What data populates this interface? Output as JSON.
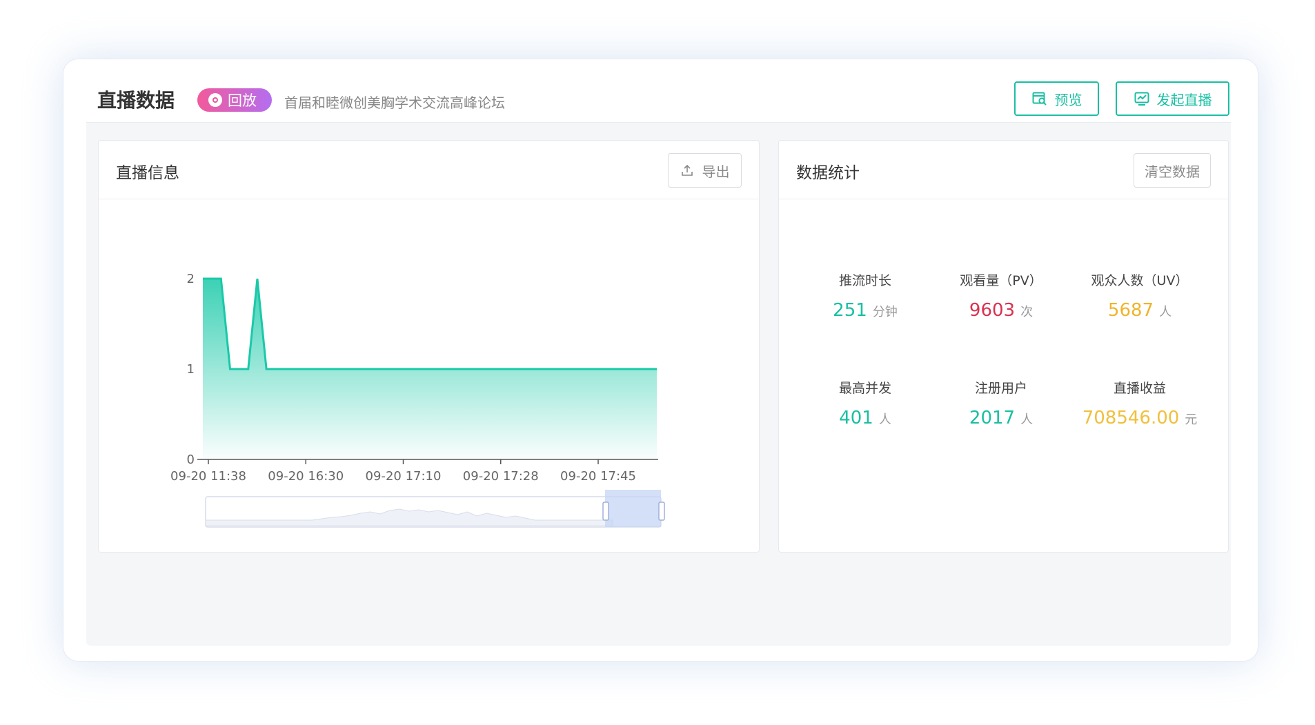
{
  "header": {
    "title": "直播数据",
    "badge_label": "回放",
    "event_name": "首届和睦微创美胸学术交流高峰论坛",
    "preview_label": "预览",
    "start_live_label": "发起直播"
  },
  "live_info": {
    "title": "直播信息",
    "export_label": "导出"
  },
  "stats_panel": {
    "title": "数据统计",
    "clear_label": "清空数据",
    "items": [
      {
        "label": "推流时长",
        "value": "251",
        "unit": "分钟",
        "color": "#19bfa3"
      },
      {
        "label": "观看量（PV）",
        "value": "9603",
        "unit": "次",
        "color": "#d9314f"
      },
      {
        "label": "观众人数（UV）",
        "value": "5687",
        "unit": "人",
        "color": "#f0b428"
      },
      {
        "label": "最高并发",
        "value": "401",
        "unit": "人",
        "color": "#19bfa3"
      },
      {
        "label": "注册用户",
        "value": "2017",
        "unit": "人",
        "color": "#19bfa3"
      },
      {
        "label": "直播收益",
        "value": "708546.00",
        "unit": "元",
        "color": "#f0c03c"
      }
    ]
  },
  "chart_data": {
    "type": "area",
    "title": "",
    "xlabel": "",
    "ylabel": "",
    "x_tick_labels": [
      "09-20 11:38",
      "09-20 16:30",
      "09-20 17:10",
      "09-20 17:28",
      "09-20 17:45"
    ],
    "y_tick_labels": [
      "0",
      "1",
      "2"
    ],
    "ylim": [
      0,
      2
    ],
    "series": [
      {
        "values": [
          2,
          2,
          2,
          1,
          1,
          1,
          2,
          1,
          1,
          1,
          1,
          1,
          1,
          1,
          1,
          1,
          1,
          1,
          1,
          1,
          1,
          1,
          1,
          1,
          1,
          1,
          1,
          1,
          1,
          1,
          1,
          1,
          1,
          1,
          1,
          1,
          1,
          1,
          1,
          1,
          1,
          1,
          1,
          1,
          1,
          1,
          1,
          1,
          1,
          1,
          1
        ]
      }
    ],
    "color": "#19c9a8",
    "grid": false,
    "data_zoom": {
      "start": 0.9,
      "end": 1.0
    }
  }
}
